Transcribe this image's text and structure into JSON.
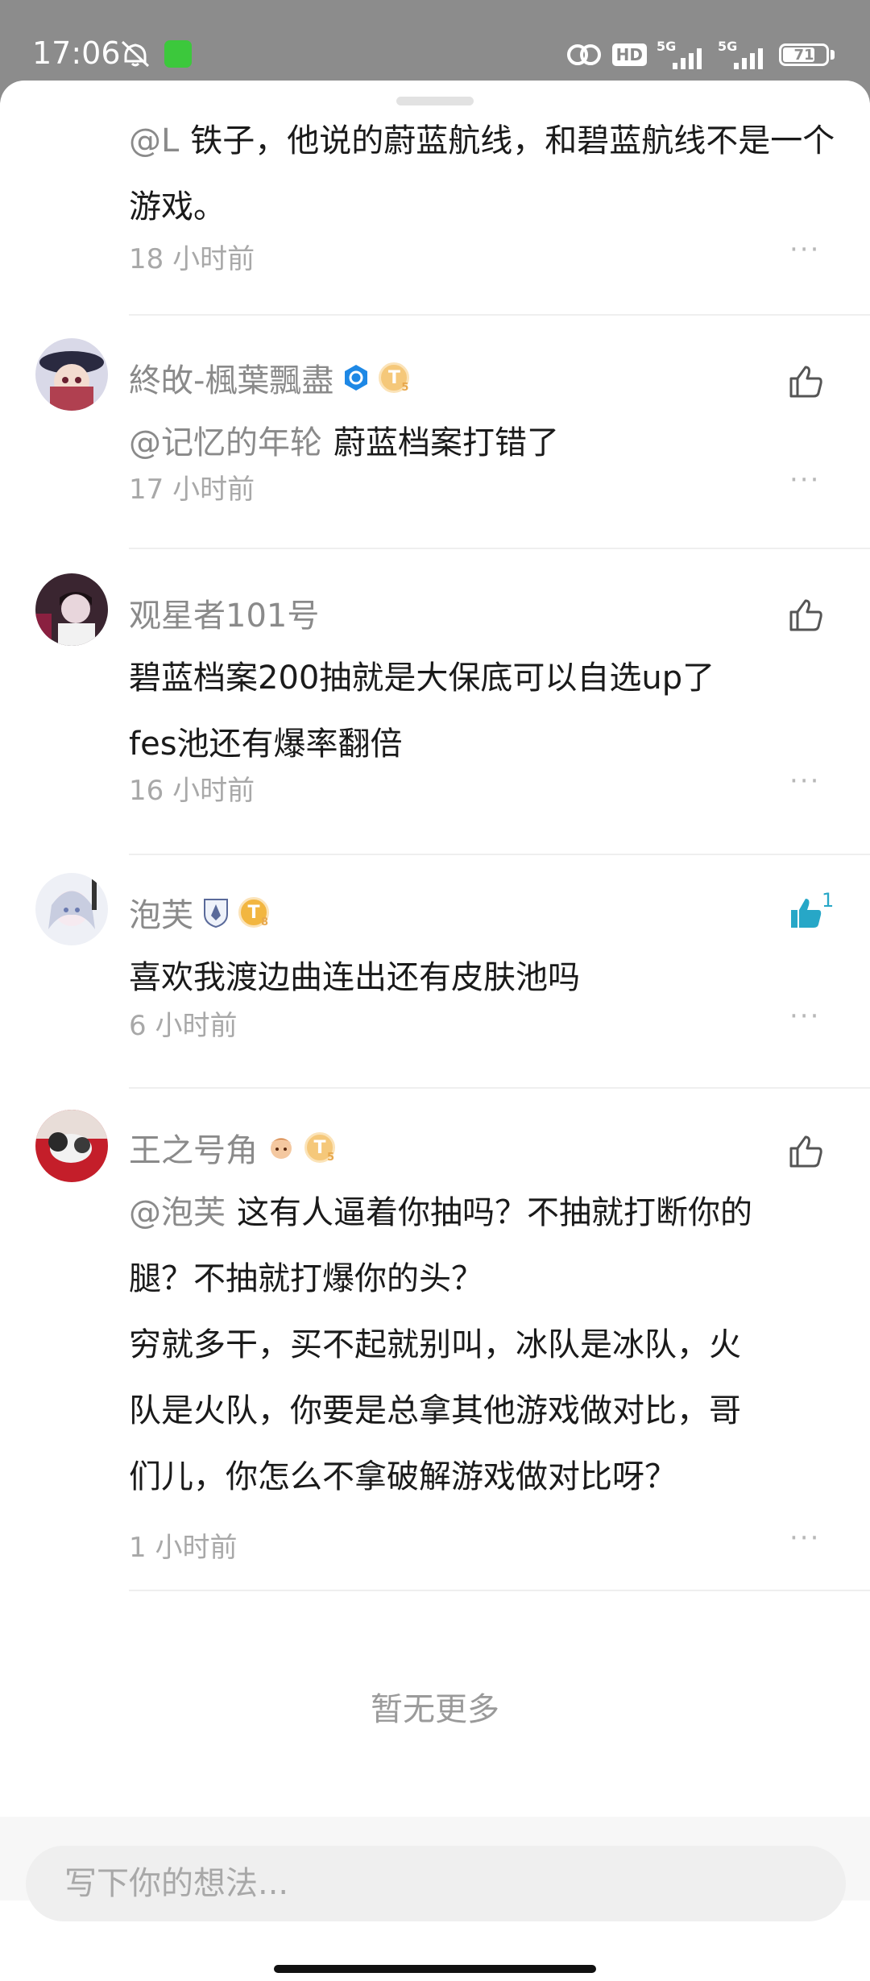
{
  "status_bar": {
    "time": "17:06",
    "hd_label": "HD",
    "signal1_label": "5G",
    "signal2_label": "5G",
    "battery_percent": "71",
    "icons": [
      "mute-icon",
      "app-notification-icon",
      "hotspot-icon",
      "signal-icon",
      "battery-icon"
    ]
  },
  "comments": [
    {
      "mention": "@L",
      "text": "铁子，他说的蔚蓝航线，和碧蓝航线不是一个游戏。",
      "time": "18 小时前"
    },
    {
      "name": "終敀-楓葉飄盡",
      "mention": "@记忆的年轮",
      "text": "蔚蓝档案打错了",
      "time": "17 小时前",
      "level": "T",
      "level_sub": "5"
    },
    {
      "name": "观星者101号",
      "text_line1": "碧蓝档案200抽就是大保底可以自选up了",
      "text_line2": "fes池还有爆率翻倍",
      "time": "16 小时前"
    },
    {
      "name": "泡芙",
      "text": "喜欢我渡边曲连出还有皮肤池吗",
      "time": "6 小时前",
      "level": "T",
      "level_sub": "8",
      "like_count": "1"
    },
    {
      "name": "王之号角",
      "mention": "@泡芙",
      "text_line1": "这有人逼着你抽吗？不抽就打断你的",
      "text_line2": "腿？不抽就打爆你的头？",
      "text_line3": "穷就多干，买不起就别叫，冰队是冰队，火",
      "text_line4": "队是火队，你要是总拿其他游戏做对比，哥",
      "text_line5": "们儿，你怎么不拿破解游戏做对比呀？",
      "time": "1 小时前",
      "level": "T",
      "level_sub": "5"
    }
  ],
  "more_label": "···",
  "no_more": "暂无更多",
  "input": {
    "placeholder": "写下你的想法..."
  },
  "colors": {
    "accent": "#27a7c7",
    "muted": "#8a8a8a",
    "verify_blue": "#1e88e5"
  }
}
